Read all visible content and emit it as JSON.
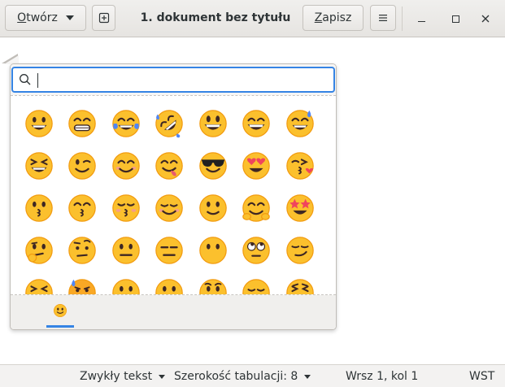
{
  "header": {
    "open_button": "Otwórz",
    "open_mnemonic": "O",
    "title": "1. dokument bez tytułu",
    "save_button": "Zapisz",
    "save_mnemonic": "Z"
  },
  "emoji_picker": {
    "search_value": "",
    "emojis": [
      {
        "face": "smile",
        "name": "grinning-face"
      },
      {
        "face": "grin",
        "name": "beaming-face"
      },
      {
        "face": "tears",
        "name": "face-with-tears-of-joy"
      },
      {
        "face": "rofl",
        "name": "rolling-on-floor-laughing"
      },
      {
        "face": "bigsmile",
        "name": "grinning-face-big-eyes"
      },
      {
        "face": "smileeyes",
        "name": "grinning-face-smiling-eyes"
      },
      {
        "face": "sweat",
        "name": "grinning-face-sweat"
      },
      {
        "face": "squint",
        "name": "grinning-squinting-face"
      },
      {
        "face": "wink",
        "name": "winking-face"
      },
      {
        "face": "blush",
        "name": "smiling-face-smiling-eyes"
      },
      {
        "face": "yum",
        "name": "face-savoring-food"
      },
      {
        "face": "cool",
        "name": "smiling-face-sunglasses"
      },
      {
        "face": "hearteyes",
        "name": "smiling-face-heart-eyes"
      },
      {
        "face": "kissheart",
        "name": "face-blowing-kiss"
      },
      {
        "face": "kiss",
        "name": "kissing-face"
      },
      {
        "face": "kisssmile",
        "name": "kissing-face-smiling-eyes"
      },
      {
        "face": "kissclosed",
        "name": "kissing-face-closed-eyes"
      },
      {
        "face": "relaxed",
        "name": "smiling-face"
      },
      {
        "face": "slight",
        "name": "slightly-smiling-face"
      },
      {
        "face": "hug",
        "name": "hugging-face"
      },
      {
        "face": "stars",
        "name": "star-struck"
      },
      {
        "face": "think",
        "name": "thinking-face"
      },
      {
        "face": "brow",
        "name": "face-raised-eyebrow"
      },
      {
        "face": "neutral",
        "name": "neutral-face"
      },
      {
        "face": "expressionless",
        "name": "expressionless-face"
      },
      {
        "face": "nomouth",
        "name": "face-without-mouth"
      },
      {
        "face": "rolleyes",
        "name": "face-rolling-eyes"
      },
      {
        "face": "smirk",
        "name": "smirking-face"
      },
      {
        "face": "persevere",
        "name": "persevering-face"
      },
      {
        "face": "worried",
        "name": "sad-face-sweat"
      },
      {
        "face": "openmouth",
        "name": "face-open-mouth"
      },
      {
        "face": "zipper",
        "name": "zipper-mouth-face"
      },
      {
        "face": "hushed",
        "name": "hushed-face"
      },
      {
        "face": "sleepy",
        "name": "sleepy-face"
      },
      {
        "face": "tired",
        "name": "tired-face"
      }
    ],
    "category_tab_icon": "slightly-smiling-face"
  },
  "statusbar": {
    "language": "Zwykły tekst",
    "tab_width": "Szerokość tabulacji: 8",
    "position": "Wrsz 1, kol 1",
    "mode": "WST"
  },
  "colors": {
    "accent": "#3584e4",
    "face_yellow": "#fbc02d",
    "face_outline": "#f29b10",
    "tongue": "#e85a6e",
    "heart": "#f0455d",
    "tear_blue": "#4f86f7"
  }
}
